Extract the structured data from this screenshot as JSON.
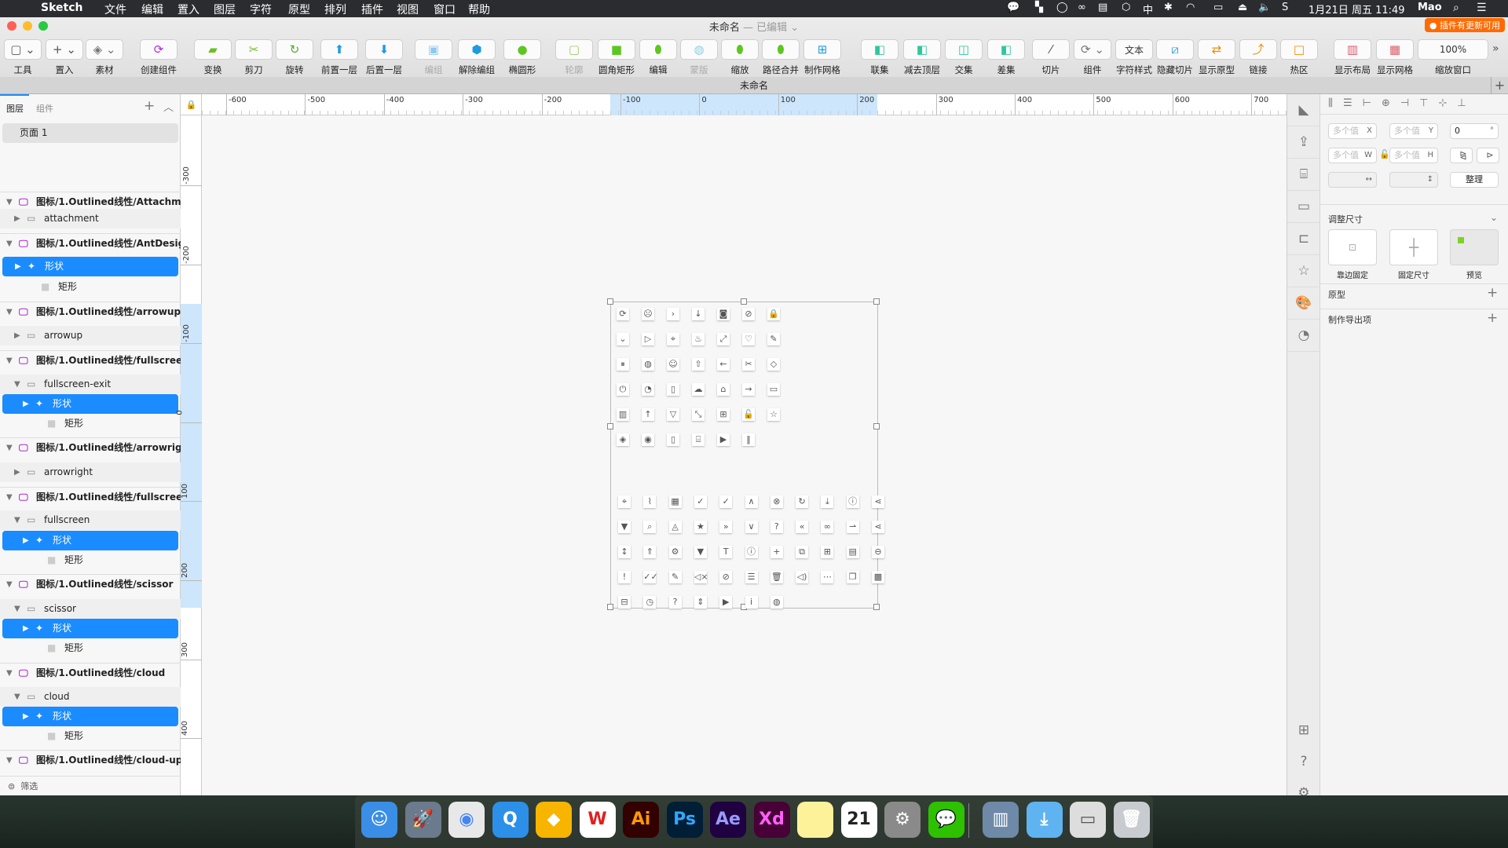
{
  "menubar": {
    "app": "Sketch",
    "items": [
      "文件",
      "编辑",
      "置入",
      "图层",
      "字符",
      "原型",
      "排列",
      "插件",
      "视图",
      "窗口",
      "帮助"
    ],
    "clock": "1月21日 周五  11:49",
    "user": "Mao",
    "input_method": "中"
  },
  "window": {
    "title": "未命名",
    "edited": " — 已编辑",
    "plugin_badge": "● 插件有更新可用",
    "doc_tab": "未命名"
  },
  "toolbar": [
    {
      "label": "工具",
      "icon": "frame-icon"
    },
    {
      "label": "置入",
      "icon": "plus-icon"
    },
    {
      "label": "素材",
      "icon": "layers-icon"
    },
    {
      "label": "创建组件",
      "icon": "symbol-icon"
    },
    {
      "label": "变换",
      "icon": "transform-icon"
    },
    {
      "label": "剪刀",
      "icon": "scissors-icon"
    },
    {
      "label": "旋转",
      "icon": "rotate-icon"
    },
    {
      "label": "前置一层",
      "icon": "forward-icon"
    },
    {
      "label": "后置一层",
      "icon": "backward-icon"
    },
    {
      "label": "编组",
      "icon": "group-icon",
      "disabled": true
    },
    {
      "label": "解除编组",
      "icon": "ungroup-icon"
    },
    {
      "label": "椭圆形",
      "icon": "oval-icon"
    },
    {
      "label": "轮廓",
      "icon": "outline-icon",
      "disabled": true
    },
    {
      "label": "圆角矩形",
      "icon": "rounded-rect-icon"
    },
    {
      "label": "编辑",
      "icon": "edit-icon"
    },
    {
      "label": "蒙版",
      "icon": "mask-icon",
      "disabled": true
    },
    {
      "label": "缩放",
      "icon": "scale-icon"
    },
    {
      "label": "路径合并",
      "icon": "flatten-icon"
    },
    {
      "label": "制作网格",
      "icon": "grid-icon"
    },
    {
      "label": "联集",
      "icon": "union-icon"
    },
    {
      "label": "减去顶层",
      "icon": "subtract-icon"
    },
    {
      "label": "交集",
      "icon": "intersect-icon"
    },
    {
      "label": "差集",
      "icon": "difference-icon"
    },
    {
      "label": "切片",
      "icon": "slice-icon"
    },
    {
      "label": "组件",
      "icon": "component-icon"
    },
    {
      "label": "字符样式",
      "icon": "text-style-icon",
      "value": "文本"
    },
    {
      "label": "隐藏切片",
      "icon": "hide-slice-icon"
    },
    {
      "label": "显示原型",
      "icon": "prototype-icon"
    },
    {
      "label": "链接",
      "icon": "link-icon"
    },
    {
      "label": "热区",
      "icon": "hotspot-icon"
    },
    {
      "label": "显示布局",
      "icon": "layout-icon"
    },
    {
      "label": "显示网格",
      "icon": "show-grid-icon"
    },
    {
      "label": "缩放窗口",
      "icon": "zoom-icon",
      "value": "100%"
    }
  ],
  "left_panel": {
    "tabs": [
      "图层",
      "组件"
    ],
    "page": "页面 1",
    "filter": "筛选",
    "layers": [
      {
        "label": "图标/1.Outlined线性/Attachment",
        "kind": "artboard"
      },
      {
        "label": "attachment",
        "kind": "folder"
      },
      {
        "label": "图标/1.Outlined线性/AntDesign",
        "kind": "artboard"
      },
      {
        "label": "形状",
        "kind": "shape",
        "selected": true
      },
      {
        "label": "矩形",
        "kind": "rect"
      },
      {
        "label": "图标/1.Outlined线性/arrowup",
        "kind": "artboard"
      },
      {
        "label": "arrowup",
        "kind": "folder"
      },
      {
        "label": "图标/1.Outlined线性/fullscreen...",
        "kind": "artboard"
      },
      {
        "label": "fullscreen-exit",
        "kind": "folder-open"
      },
      {
        "label": "形状",
        "kind": "shape2",
        "selected": true
      },
      {
        "label": "矩形",
        "kind": "rect2"
      },
      {
        "label": "图标/1.Outlined线性/arrowright",
        "kind": "artboard"
      },
      {
        "label": "arrowright",
        "kind": "folder"
      },
      {
        "label": "图标/1.Outlined线性/fullscreen",
        "kind": "artboard"
      },
      {
        "label": "fullscreen",
        "kind": "folder-open"
      },
      {
        "label": "形状",
        "kind": "shape2",
        "selected": true
      },
      {
        "label": "矩形",
        "kind": "rect2"
      },
      {
        "label": "图标/1.Outlined线性/scissor",
        "kind": "artboard"
      },
      {
        "label": "scissor",
        "kind": "folder-open"
      },
      {
        "label": "形状",
        "kind": "shape2",
        "selected": true
      },
      {
        "label": "矩形",
        "kind": "rect2"
      },
      {
        "label": "图标/1.Outlined线性/cloud",
        "kind": "artboard"
      },
      {
        "label": "cloud",
        "kind": "folder-open"
      },
      {
        "label": "形状",
        "kind": "shape2",
        "selected": true
      },
      {
        "label": "矩形",
        "kind": "rect2"
      },
      {
        "label": "图标/1.Outlined线性/cloud-upl...",
        "kind": "artboard"
      }
    ]
  },
  "rulers": {
    "h": [
      "-600",
      "-500",
      "-400",
      "-300",
      "-200",
      "-100",
      "0",
      "100",
      "200",
      "300",
      "400",
      "500",
      "600",
      "700"
    ],
    "v": [
      "-300",
      "-200",
      "-100",
      "0",
      "100",
      "200",
      "300",
      "400"
    ]
  },
  "inspector": {
    "x": "多个值",
    "y": "多个值",
    "rotation": "0",
    "w": "多个值",
    "h": "多个值",
    "tidy": "整理",
    "resizing": "调整尺寸",
    "pin_edges": "靠边固定",
    "fix_size": "固定尺寸",
    "preview": "预览",
    "prototype": "原型",
    "export": "制作导出项"
  },
  "canvas": {
    "icons_top": [
      "sync",
      "frown",
      "right-circle",
      "arrow-down",
      "camera",
      "stop",
      "lock",
      "down-circle",
      "play-circle",
      "environment",
      "fire",
      "expand",
      "heart",
      "edit",
      "pause-circle",
      "global",
      "team",
      "cloud-upload",
      "arrow-left",
      "scissor",
      "tag",
      "poweroff",
      "pie-chart",
      "book",
      "cloud",
      "home",
      "arrow-right",
      "folder",
      "bar-chart",
      "arrow-up",
      "dislike",
      "compress",
      "appstore",
      "unlock",
      "star",
      "tags",
      "eye",
      "file",
      "shop",
      "caret-right",
      "pause"
    ],
    "icons_bottom": [
      "aim",
      "paperclip",
      "calendar",
      "check",
      "check-circle",
      "up",
      "close-circle",
      "reload",
      "download",
      "exclamation-circle",
      "share-filled",
      "filter",
      "search",
      "bell",
      "star-filled",
      "double-right",
      "down",
      "question-circle",
      "double-left",
      "link",
      "enter",
      "share",
      "line-height",
      "rocket",
      "setting",
      "caret-down",
      "font",
      "info-circle",
      "plus",
      "copy-plus",
      "plus-square",
      "file-done",
      "minus-circle-filled",
      "exclamation-filled",
      "double-check",
      "form",
      "mute",
      "eye-invisible",
      "indent",
      "delete",
      "sound",
      "ellipsis",
      "copy",
      "transparent",
      "minus-square",
      "clock",
      "question-filled",
      "swap-vertical",
      "caret-right",
      "info-filled",
      "global"
    ]
  },
  "dock": [
    {
      "name": "finder"
    },
    {
      "name": "launchpad"
    },
    {
      "name": "chrome"
    },
    {
      "name": "qq-browser"
    },
    {
      "name": "sketch"
    },
    {
      "name": "wps",
      "label": "W"
    },
    {
      "name": "illustrator",
      "label": "Ai"
    },
    {
      "name": "photoshop",
      "label": "Ps"
    },
    {
      "name": "after-effects",
      "label": "Ae"
    },
    {
      "name": "xd",
      "label": "Xd"
    },
    {
      "name": "notes"
    },
    {
      "name": "calendar",
      "label": "21"
    },
    {
      "name": "system-preferences"
    },
    {
      "name": "wechat"
    },
    {
      "name": "applications"
    },
    {
      "name": "downloads"
    },
    {
      "name": "preview"
    },
    {
      "name": "trash"
    }
  ]
}
